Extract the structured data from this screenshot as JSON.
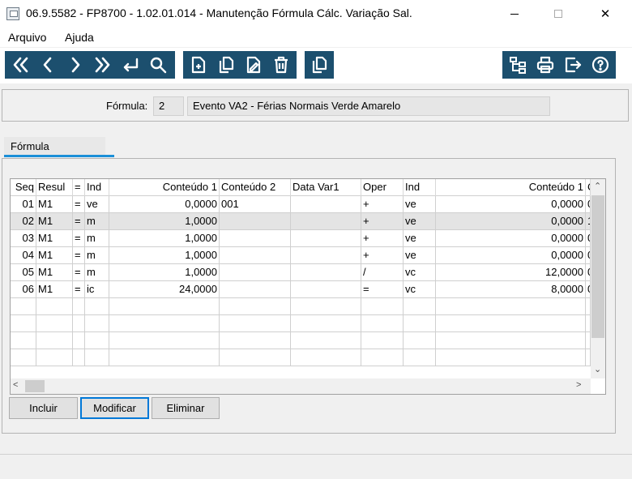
{
  "window": {
    "title": "06.9.5582 - FP8700 - 1.02.01.014 - Manutenção Fórmula Cálc. Variação Sal.",
    "close_glyph": "✕"
  },
  "menu": {
    "items": [
      "Arquivo",
      "Ajuda"
    ]
  },
  "toolbar": {
    "nav_icons": [
      "first-icon",
      "previous-icon",
      "next-icon",
      "last-icon",
      "return-icon",
      "search-icon"
    ],
    "edit_icons": [
      "new-icon",
      "copy-icon",
      "edit-icon",
      "delete-icon"
    ],
    "extra_icons": [
      "duplicate-icon"
    ],
    "right_icons": [
      "tree-icon",
      "print-icon",
      "exit-icon",
      "help-icon"
    ],
    "color": "#1c4f6e"
  },
  "header": {
    "formula_label": "Fórmula:",
    "formula_code": "2",
    "formula_desc": "Evento VA2 - Férias Normais Verde Amarelo"
  },
  "tab": {
    "label": "Fórmula",
    "accent": "#1b8fd8"
  },
  "grid": {
    "columns": [
      "Seq",
      "Resul",
      "=",
      "Ind",
      "Conteúdo 1",
      "Conteúdo 2",
      "Data Var1",
      "Oper",
      "Ind",
      "Conteúdo 1",
      "C"
    ],
    "rows": [
      [
        "01",
        "M1",
        "=",
        "ve",
        "0,0000",
        "001",
        "",
        "+",
        "ve",
        "0,0000",
        "0"
      ],
      [
        "02",
        "M1",
        "=",
        "m",
        "1,0000",
        "",
        "",
        "+",
        "ve",
        "0,0000",
        "1"
      ],
      [
        "03",
        "M1",
        "=",
        "m",
        "1,0000",
        "",
        "",
        "+",
        "ve",
        "0,0000",
        "0"
      ],
      [
        "04",
        "M1",
        "=",
        "m",
        "1,0000",
        "",
        "",
        "+",
        "ve",
        "0,0000",
        "0"
      ],
      [
        "05",
        "M1",
        "=",
        "m",
        "1,0000",
        "",
        "",
        "/",
        "vc",
        "12,0000",
        "0"
      ],
      [
        "06",
        "M1",
        "=",
        "ic",
        "24,0000",
        "",
        "",
        "=",
        "vc",
        "8,0000",
        "0"
      ]
    ],
    "selected_row": 1,
    "empty_rows": 4
  },
  "buttons": {
    "incluir": "Incluir",
    "modificar": "Modificar",
    "eliminar": "Eliminar"
  }
}
